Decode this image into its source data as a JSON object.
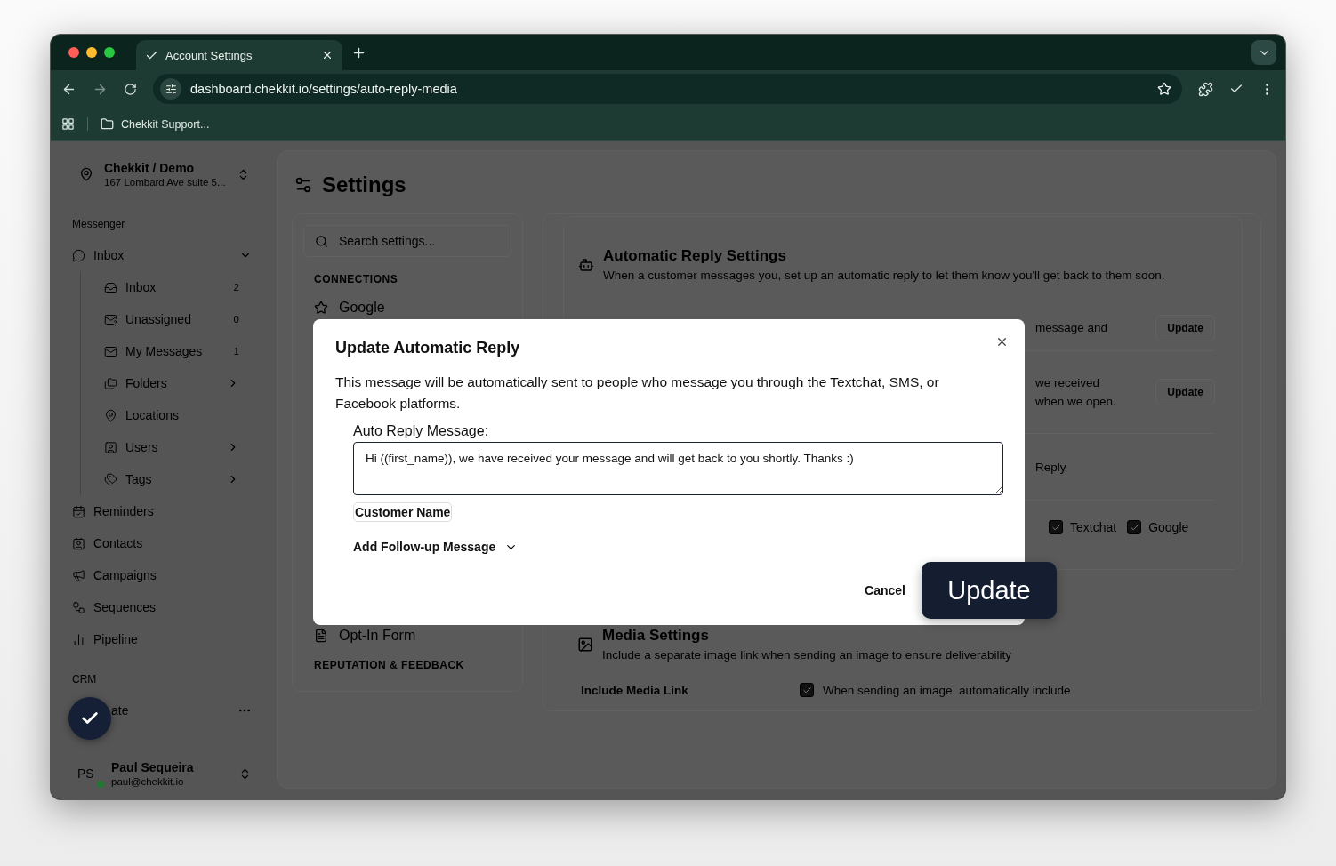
{
  "browser": {
    "tab_title": "Account Settings",
    "url": "dashboard.chekkit.io/settings/auto-reply-media",
    "bookmark": "Chekkit Support..."
  },
  "sidebar": {
    "org": {
      "name": "Chekkit / Demo",
      "address": "167 Lombard Ave suite 5..."
    },
    "sections": [
      {
        "label": "Messenger",
        "items": [
          {
            "label": "Inbox",
            "kind": "group",
            "expanded": true,
            "children": [
              {
                "label": "Inbox",
                "kind": "count",
                "count": "2"
              },
              {
                "label": "Unassigned",
                "kind": "count",
                "count": "0"
              },
              {
                "label": "My Messages",
                "kind": "count",
                "count": "1"
              },
              {
                "label": "Folders",
                "kind": "submenu"
              },
              {
                "label": "Locations",
                "kind": "link"
              },
              {
                "label": "Users",
                "kind": "submenu"
              },
              {
                "label": "Tags",
                "kind": "submenu"
              }
            ]
          },
          {
            "label": "Reminders",
            "kind": "link"
          },
          {
            "label": "Contacts",
            "kind": "link"
          },
          {
            "label": "Campaigns",
            "kind": "link"
          },
          {
            "label": "Sequences",
            "kind": "link"
          },
          {
            "label": "Pipeline",
            "kind": "link"
          }
        ]
      },
      {
        "label": "CRM",
        "items": [
          {
            "label": "ate",
            "kind": "more"
          }
        ]
      }
    ],
    "user": {
      "initials": "PS",
      "name": "Paul Sequeira",
      "email": "paul@chekkit.io",
      "online": true
    }
  },
  "settings": {
    "title": "Settings",
    "search_placeholder": "Search settings...",
    "nav": [
      {
        "kind": "heading",
        "label": "CONNECTIONS"
      },
      {
        "kind": "item",
        "label": "Google"
      },
      {
        "kind": "item",
        "label": "Opt-In Form"
      },
      {
        "kind": "heading",
        "label": "REPUTATION & FEEDBACK"
      }
    ]
  },
  "auto_reply": {
    "title": "Automatic Reply Settings",
    "description": "When a customer messages you, set up an automatic reply to let them know you'll get back to them soon.",
    "rows": [
      {
        "kind": "button",
        "lines": [
          "message and"
        ],
        "button": "Update"
      },
      {
        "kind": "button",
        "lines": [
          "we received",
          "when we open."
        ],
        "button": "Update"
      },
      {
        "kind": "text",
        "lines": [
          "Reply"
        ]
      },
      {
        "kind": "checks",
        "checks": [
          {
            "label": "Textchat",
            "checked": true
          },
          {
            "label": "Google",
            "checked": true
          }
        ]
      }
    ]
  },
  "media": {
    "title": "Media Settings",
    "description": "Include a separate image link when sending an image to ensure deliverability",
    "option": "Include Media Link",
    "checked": true,
    "option_text": "When sending an image, automatically include"
  },
  "modal": {
    "title": "Update Automatic Reply",
    "body": "This message will be automatically sent to people who message you through the Textchat, SMS, or Facebook platforms.",
    "field_label": "Auto Reply Message:",
    "value": "Hi ((first_name)), we have received your message and will get back to you shortly. Thanks :)",
    "chips": [
      "Customer Name"
    ],
    "follow_up": "Add Follow-up Message",
    "cancel": "Cancel",
    "submit": "Update"
  }
}
